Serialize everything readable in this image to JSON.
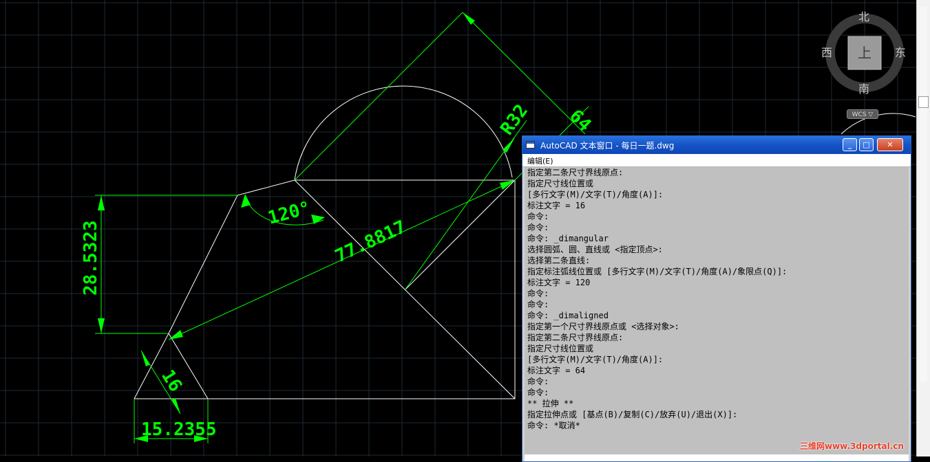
{
  "drawing": {
    "dimensions": {
      "height": "28.5323",
      "diagonal": "77.8817",
      "side": "64",
      "radius": "R32",
      "angle": "120°",
      "small_len": "16",
      "base_len": "15.2355"
    }
  },
  "viewcube": {
    "north": "北",
    "south": "南",
    "east": "东",
    "west": "西",
    "face": "上",
    "ucs_label": "WCS ▽"
  },
  "text_window": {
    "title": "AutoCAD 文本窗口 - 每日一题.dwg",
    "menu_edit": "编辑(E)",
    "lines": [
      "指定第二条尺寸界线原点:",
      "指定尺寸线位置或",
      "[多行文字(M)/文字(T)/角度(A)]:",
      "标注文字 = 16",
      "命令:",
      "命令:",
      "命令: _dimangular",
      "选择圆弧、圆、直线或 <指定顶点>:",
      "选择第二条直线:",
      "指定标注弧线位置或 [多行文字(M)/文字(T)/角度(A)/象限点(Q)]:",
      "标注文字 = 120",
      "命令:",
      "命令:",
      "命令: _dimaligned",
      "指定第一个尺寸界线原点或 <选择对象>:",
      "指定第二条尺寸界线原点:",
      "指定尺寸线位置或",
      "[多行文字(M)/文字(T)/角度(A)]:",
      "标注文字 = 64",
      "命令:",
      "命令:",
      "** 拉伸 **",
      "指定拉伸点或 [基点(B)/复制(C)/放弃(U)/退出(X)]:",
      "命令: *取消*"
    ]
  },
  "watermark": "三维网www.3dportal.cn",
  "colors": {
    "geometry": "#ffffff",
    "dimension": "#00ff00",
    "grid": "#1e2a34",
    "titlebar": "#1553c6"
  }
}
